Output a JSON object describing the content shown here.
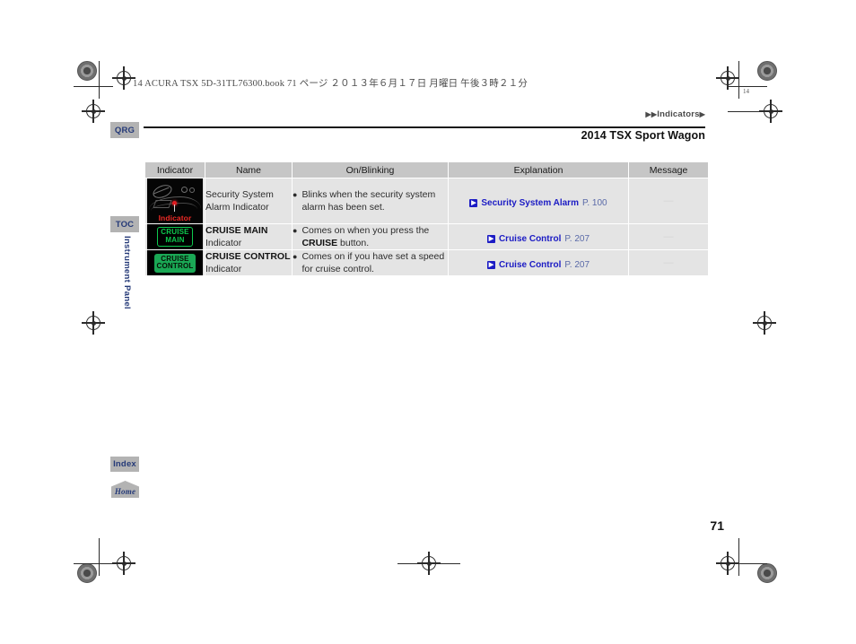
{
  "document": {
    "book_header": "14 ACURA TSX 5D-31TL76300.book  71 ページ  ２０１３年６月１７日  月曜日  午後３時２１分",
    "model_title": "2014 TSX Sport Wagon",
    "page_number": "71",
    "corner_mark_number": "14"
  },
  "topnav": {
    "prefix": "▶▶",
    "label": "Indicators",
    "suffix": "▶"
  },
  "sidebar": {
    "qrg_label": "QRG",
    "toc_label": "TOC",
    "section_label": "Instrument Panel",
    "index_label": "Index",
    "home_label": "Home"
  },
  "table": {
    "headers": [
      "Indicator",
      "Name",
      "On/Blinking",
      "Explanation",
      "Message"
    ],
    "rows": [
      {
        "icon": {
          "type": "security-alarm-indicator-photo",
          "caption": "Indicator",
          "caption_color": "#ef2a25"
        },
        "name_strong": "",
        "name_line1": "Security System",
        "name_line2": "Alarm Indicator",
        "onblinking_line1": "Blinks when the security system",
        "onblinking_bold": "",
        "onblinking_line2": "alarm has been set.",
        "link_text": "Security System Alarm",
        "link_page": "P. 100",
        "link_arrow": "▶",
        "message": "—"
      },
      {
        "icon": {
          "type": "cruise-main-outline-badge",
          "text_line1": "CRUISE",
          "text_line2": "MAIN",
          "color": "#0ec94e"
        },
        "name_strong": "CRUISE MAIN",
        "name_line1": "Indicator",
        "name_line2": "",
        "onblinking_line1": "Comes on when you press the",
        "onblinking_bold": "CRUISE",
        "onblinking_line2": " button.",
        "link_text": "Cruise Control",
        "link_page": "P. 207",
        "link_arrow": "▶",
        "message": "—"
      },
      {
        "icon": {
          "type": "cruise-control-filled-badge",
          "text_line1": "CRUISE",
          "text_line2": "CONTROL",
          "color": "#1aa855"
        },
        "name_strong": "CRUISE CONTROL",
        "name_line1": "Indicator",
        "name_line2": "",
        "onblinking_line1": "Comes on if you have set a speed",
        "onblinking_bold": "",
        "onblinking_line2": "for cruise control.",
        "link_text": "Cruise Control",
        "link_page": "P. 207",
        "link_arrow": "▶",
        "message": "—"
      }
    ]
  },
  "colors": {
    "tab_bg": "#b3b3b3",
    "tab_text": "#253a78",
    "header_cell_bg": "#c6c6c6",
    "body_cell_bg": "#e4e4e4",
    "message_cell_bg": "#4a4a4a",
    "link_blue": "#1b1bc4"
  }
}
